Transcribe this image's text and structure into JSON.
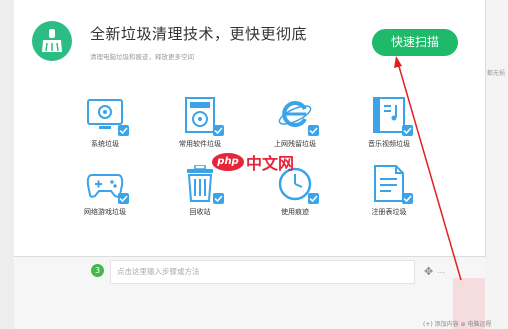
{
  "header": {
    "title": "全新垃圾清理技术，更快更彻底",
    "subtitle": "清理电脑垃圾和痕迹，释放更多空间",
    "scan_button": "快速扫描"
  },
  "items": [
    {
      "label": "系统垃圾",
      "icon": "system-trash-icon"
    },
    {
      "label": "常用软件垃圾",
      "icon": "software-trash-icon"
    },
    {
      "label": "上网残留垃圾",
      "icon": "internet-explorer-icon"
    },
    {
      "label": "音乐视频垃圾",
      "icon": "music-video-icon"
    },
    {
      "label": "网络游戏垃圾",
      "icon": "gamepad-icon"
    },
    {
      "label": "回收站",
      "icon": "recycle-bin-icon"
    },
    {
      "label": "使用痕迹",
      "icon": "clock-icon"
    },
    {
      "label": "注册表垃圾",
      "icon": "registry-icon"
    }
  ],
  "watermark": {
    "logo": "php",
    "text": "中文网"
  },
  "step": {
    "number": "3",
    "placeholder": "点击这里输入步骤或方法"
  },
  "right_edge_text": "都无损",
  "bottom_links": "(+) 添加内容  ⊕ 电脑远程",
  "colors": {
    "accent_green": "#1fb96a",
    "check_blue": "#3ba3e8",
    "arrow_red": "#e02020"
  }
}
